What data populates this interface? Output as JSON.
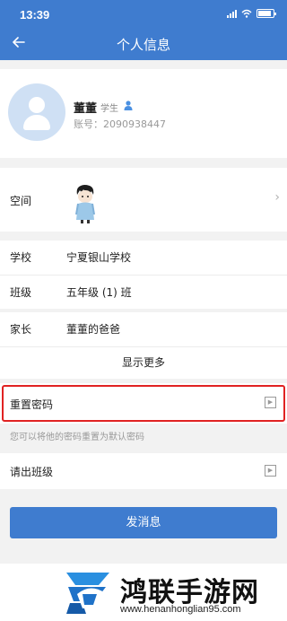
{
  "status_bar": {
    "time": "13:39"
  },
  "header": {
    "title": "个人信息",
    "back_icon": "arrow-left-icon"
  },
  "profile": {
    "name": "董董",
    "role": "学生",
    "account": "账号：2090938447"
  },
  "space": {
    "label": "空间"
  },
  "school_info": [
    {
      "label": "学校",
      "value": "宁夏银山学校"
    },
    {
      "label": "班级",
      "value": "五年级 (1) 班"
    }
  ],
  "parent_info": [
    {
      "label": "家长",
      "value": "董董的爸爸"
    }
  ],
  "show_more": "显示更多",
  "reset_password": {
    "label": "重置密码",
    "hint": "您可以将他的密码重置为默认密码"
  },
  "remove_from_class": {
    "label": "请出班级"
  },
  "send_message": "发消息",
  "watermark": {
    "text": "鸿联手游网",
    "url": "www.henanhonglian95.com"
  },
  "colors": {
    "primary": "#3f7ccf",
    "highlight": "#e02222",
    "background": "#f2f2f2"
  }
}
